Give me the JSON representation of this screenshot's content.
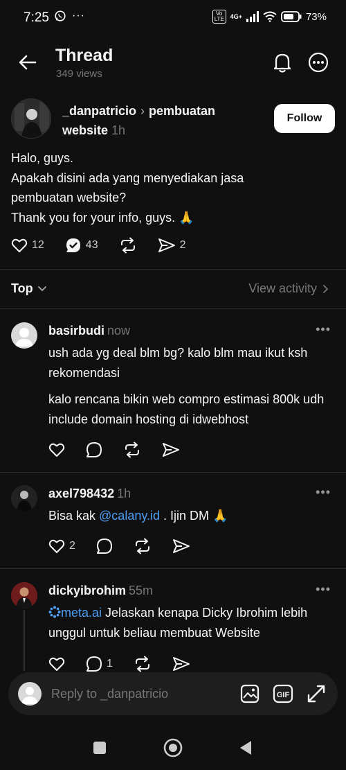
{
  "status": {
    "time": "7:25",
    "battery": "73%",
    "network": "4G+",
    "volte": "Vo LTE"
  },
  "header": {
    "title": "Thread",
    "views": "349 views"
  },
  "post": {
    "author": "_danpatricio",
    "community": "pembuatan website",
    "time": "1h",
    "follow_label": "Follow",
    "text_lines": [
      "Halo, guys.",
      "Apakah disini ada yang menyediakan jasa",
      "pembuatan website?",
      "Thank you for your info, guys. 🙏"
    ],
    "likes": "12",
    "replies": "43",
    "shares": "2"
  },
  "sort": {
    "label": "Top",
    "view_activity": "View activity"
  },
  "replies": [
    {
      "author": "basirbudi",
      "time": "now",
      "para1": "ush ada yg deal blm bg? kalo blm mau ikut ksh rekomendasi",
      "para2": "kalo rencana bikin web compro estimasi 800k udh include domain hosting di idwebhost"
    },
    {
      "author": "axel798432",
      "time": "1h",
      "text_pre": "Bisa kak ",
      "mention": "@calany.id",
      "text_post": " . Ijin DM 🙏",
      "likes": "2"
    },
    {
      "author": "dickyibrohim",
      "time": "55m",
      "mention": "meta.ai",
      "text_post": " Jelaskan kenapa Dicky Ibrohim lebih unggul untuk beliau membuat Website",
      "replies": "1"
    }
  ],
  "composer": {
    "placeholder": "Reply to _danpatricio"
  },
  "colors": {
    "background": "#101010",
    "text": "#f3f5f7",
    "muted": "#777777",
    "link": "#4d9ff5"
  }
}
